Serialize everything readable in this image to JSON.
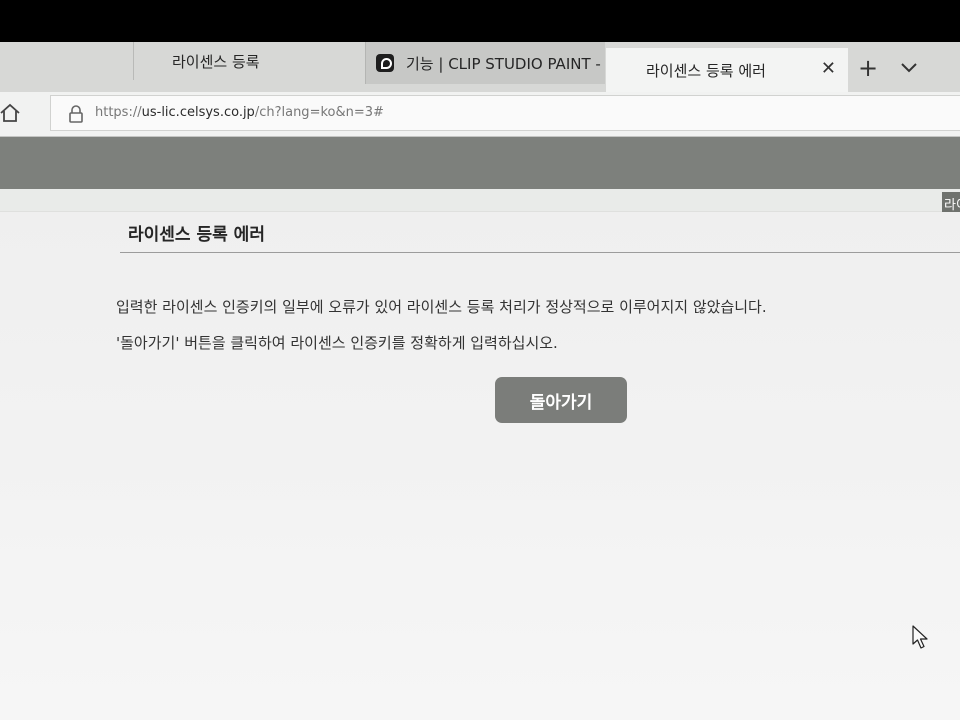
{
  "tabs": [
    {
      "label": "라이센스 등록",
      "active": false
    },
    {
      "label": "기능 | CLIP STUDIO PAINT -",
      "active": false,
      "favicon": "clip-studio-icon"
    },
    {
      "label": "라이센스 등록 에러",
      "active": true
    }
  ],
  "tabstrip": {
    "close_glyph": "✕",
    "add_glyph": "+"
  },
  "address": {
    "scheme": "https://",
    "host": "us-lic.celsys.co.jp",
    "path": "/ch?lang=ko&n=3#"
  },
  "nav": {
    "partial_label": "라이"
  },
  "page": {
    "heading": "라이센스 등록 에러",
    "message_1": "입력한 라이센스 인증키의 일부에 오류가 있어 라이센스 등록 처리가 정상적으로 이루어지지 않았습니다.",
    "message_2": "'돌아가기' 버튼을 클릭하여 라이센스 인증키를 정확하게 입력하십시오.",
    "back_button": "돌아가기"
  },
  "colors": {
    "header_band": "#7d807c",
    "button": "#7b7d7a",
    "page_background": "#f1f1f1"
  }
}
